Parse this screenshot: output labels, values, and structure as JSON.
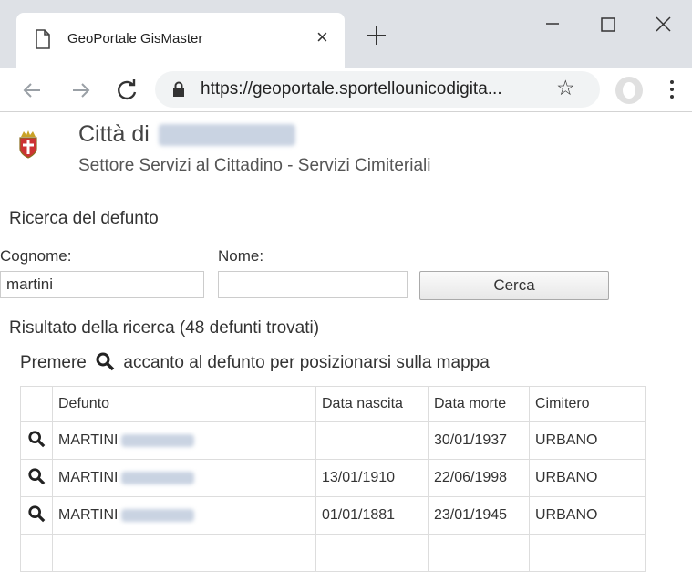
{
  "browser": {
    "tab_title": "GeoPortale GisMaster",
    "tab_close": "×",
    "url": "https://geoportale.sportellounicodigita..."
  },
  "header": {
    "city_prefix": "Città di",
    "sector": "Settore Servizi al Cittadino - Servizi Cimiteriali"
  },
  "search": {
    "title": "Ricerca del defunto",
    "surname_label": "Cognome:",
    "name_label": "Nome:",
    "surname_value": "martini",
    "name_value": "",
    "button_label": "Cerca"
  },
  "results": {
    "summary": "Risultato della ricerca (48 defunti trovati)",
    "hint_before": "Premere",
    "hint_after": "accanto al defunto per posizionarsi sulla mappa"
  },
  "table": {
    "headers": [
      "Defunto",
      "Data nascita",
      "Data morte",
      "Cimitero"
    ],
    "rows": [
      {
        "defunto": "MARTINI",
        "nascita": "",
        "morte": "30/01/1937",
        "cimitero": "URBANO"
      },
      {
        "defunto": "MARTINI",
        "nascita": "13/01/1910",
        "morte": "22/06/1998",
        "cimitero": "URBANO"
      },
      {
        "defunto": "MARTINI",
        "nascita": "01/01/1881",
        "morte": "23/01/1945",
        "cimitero": "URBANO"
      }
    ]
  },
  "colors": {
    "tabbar": "#dee1e6",
    "omnibox": "#f1f3f4"
  }
}
